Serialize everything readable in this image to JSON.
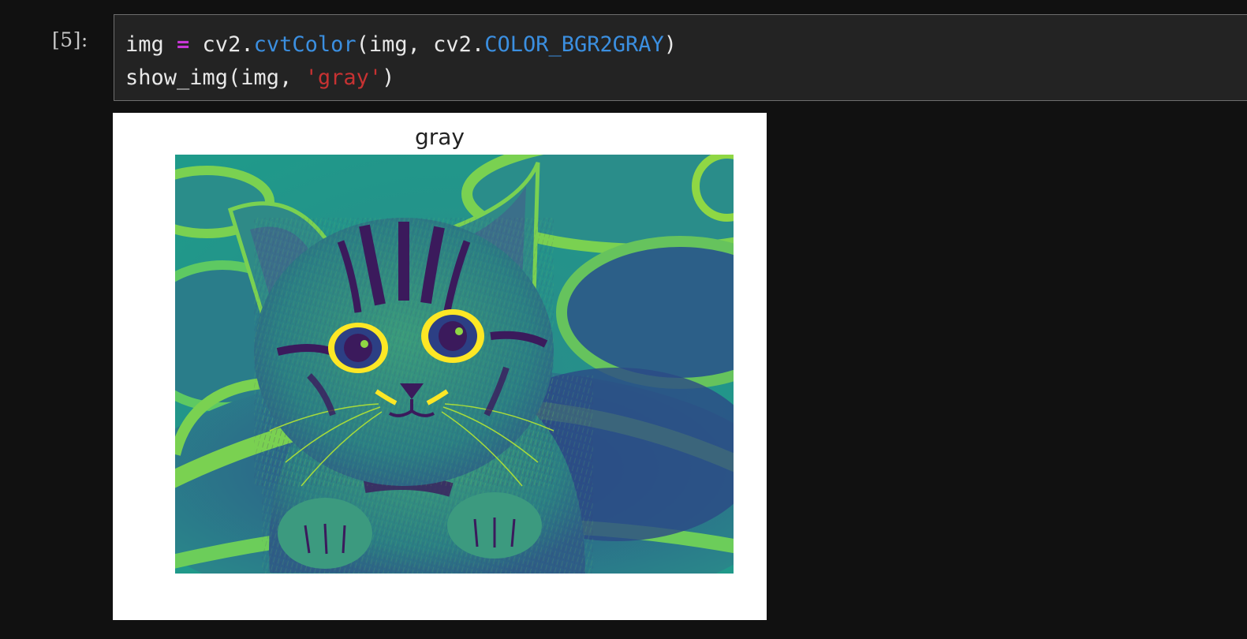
{
  "cell": {
    "prompt": "[5]:",
    "code_line1": {
      "t1": "img ",
      "t2": "=",
      "t3": " cv2.",
      "t4": "cvtColor",
      "t5": "(img, cv2.",
      "t6": "COLOR_BGR2GRAY",
      "t7": ")"
    },
    "code_line2": {
      "t1": "show_img(img, ",
      "t2": "'gray'",
      "t3": ")"
    }
  },
  "output": {
    "plot_title": "gray",
    "image_subject": "kitten in flower pot, viridis colormap"
  },
  "colors": {
    "background": "#111111",
    "editor_bg": "#232323",
    "keyword_operator": "#c837d6",
    "function_name": "#3b8fe0",
    "string": "#c73232",
    "viridis_dark": "#3b1a5c",
    "viridis_mid": "#21918c",
    "viridis_light": "#7ad151",
    "viridis_bright": "#fde725"
  }
}
